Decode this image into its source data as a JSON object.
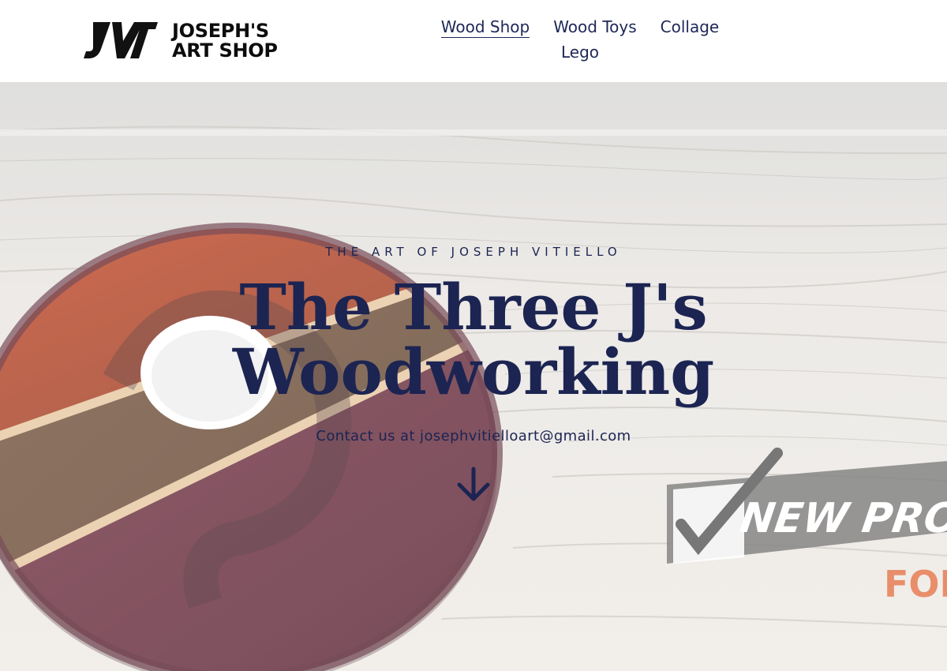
{
  "brand": {
    "name_line1": "JOSEPH'S",
    "name_line2": "ART SHOP",
    "monogram": "JV"
  },
  "nav": {
    "items": [
      {
        "label": "Wood Shop",
        "active": true
      },
      {
        "label": "Wood Toys",
        "active": false
      },
      {
        "label": "Collage",
        "active": false
      },
      {
        "label": "Lego",
        "active": false
      }
    ]
  },
  "hero": {
    "eyebrow": "THE ART OF JOSEPH VITIELLO",
    "title_line1": "The Three J's",
    "title_line2": "Woodworking",
    "contact": "Contact us at josephvitielloart@gmail.com",
    "banner_text": "NEW PRODU",
    "banner_subtext": "FOR"
  },
  "colors": {
    "text": "#1c2452",
    "header_bg": "#ffffff",
    "accent_orange": "#e36a3a"
  }
}
